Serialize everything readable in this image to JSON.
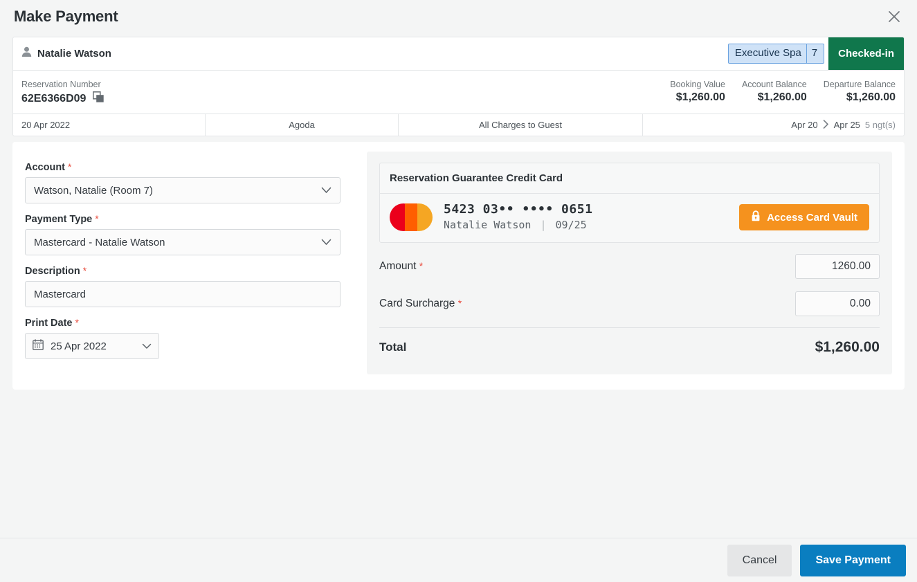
{
  "dialog": {
    "title": "Make Payment",
    "close_icon": "close-icon"
  },
  "reservation": {
    "guest_name": "Natalie Watson",
    "guest_icon": "person-icon",
    "room_type": "Executive Spa",
    "room_number": "7",
    "status": "Checked-in",
    "reservation_number_label": "Reservation Number",
    "reservation_number": "62E6366D09",
    "copy_icon": "copy-icon",
    "metrics": [
      {
        "label": "Booking Value",
        "value": "$1,260.00"
      },
      {
        "label": "Account Balance",
        "value": "$1,260.00"
      },
      {
        "label": "Departure Balance",
        "value": "$1,260.00"
      }
    ],
    "detail_row": {
      "booked_date": "20 Apr 2022",
      "source": "Agoda",
      "charge_routing": "All Charges to Guest",
      "arrival": "Apr 20",
      "arrow_icon": "chevron-right-icon",
      "departure": "Apr 25",
      "nights": "5 ngt(s)"
    }
  },
  "form": {
    "account": {
      "label": "Account",
      "required_marker": "*",
      "value": "Watson, Natalie (Room 7)",
      "chevron_icon": "chevron-down-icon"
    },
    "payment_type": {
      "label": "Payment Type",
      "required_marker": "*",
      "value": "Mastercard - Natalie Watson",
      "chevron_icon": "chevron-down-icon"
    },
    "description": {
      "label": "Description",
      "required_marker": "*",
      "value": "Mastercard",
      "placeholder": "Mastercard"
    },
    "print_date": {
      "label": "Print Date",
      "required_marker": "*",
      "value": "25 Apr 2022",
      "calendar_icon": "calendar-icon",
      "chevron_icon": "chevron-down-icon"
    }
  },
  "payment": {
    "card_panel_title": "Reservation Guarantee Credit Card",
    "card_brand_icon": "mastercard-logo",
    "card_number": "5423 03•• •••• 0651",
    "card_holder": "Natalie Watson",
    "card_expiry": "09/25",
    "vault_button": {
      "label": "Access Card Vault",
      "icon": "lock-icon",
      "color": "#f5921e"
    },
    "amount": {
      "label": "Amount",
      "required_marker": "*",
      "value": "1260.00"
    },
    "surcharge": {
      "label": "Card Surcharge",
      "required_marker": "*",
      "value": "0.00"
    },
    "total": {
      "label": "Total",
      "value": "$1,260.00"
    }
  },
  "footer": {
    "cancel_label": "Cancel",
    "save_label": "Save Payment",
    "save_color": "#0a7ec0"
  }
}
